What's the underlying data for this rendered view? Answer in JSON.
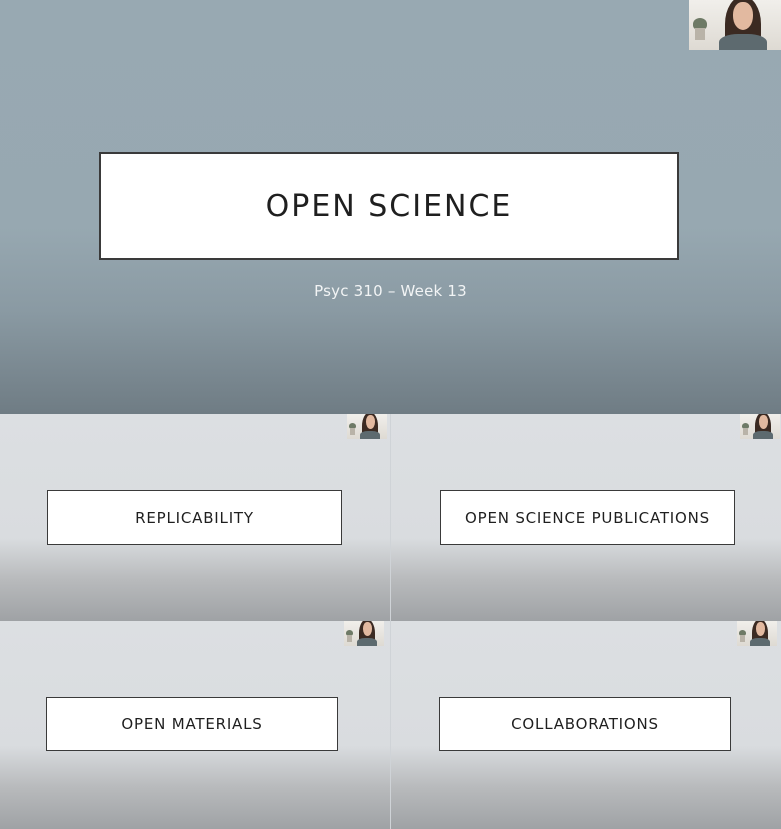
{
  "main_slide": {
    "title": "OPEN SCIENCE",
    "subtitle": "Psyc 310 – Week 13"
  },
  "thumbnails": [
    {
      "title": "REPLICABILITY"
    },
    {
      "title": "OPEN SCIENCE PUBLICATIONS"
    },
    {
      "title": "OPEN MATERIALS"
    },
    {
      "title": "COLLABORATIONS"
    }
  ],
  "icons": {
    "webcam": "presenter-webcam-icon"
  },
  "colors": {
    "main_bg": "#98a9b2",
    "thumb_bg": "#dcdfe2",
    "box_border": "#3a3a3a",
    "title_text": "#1f1f1f",
    "subtitle_text": "#f2f4f5"
  }
}
